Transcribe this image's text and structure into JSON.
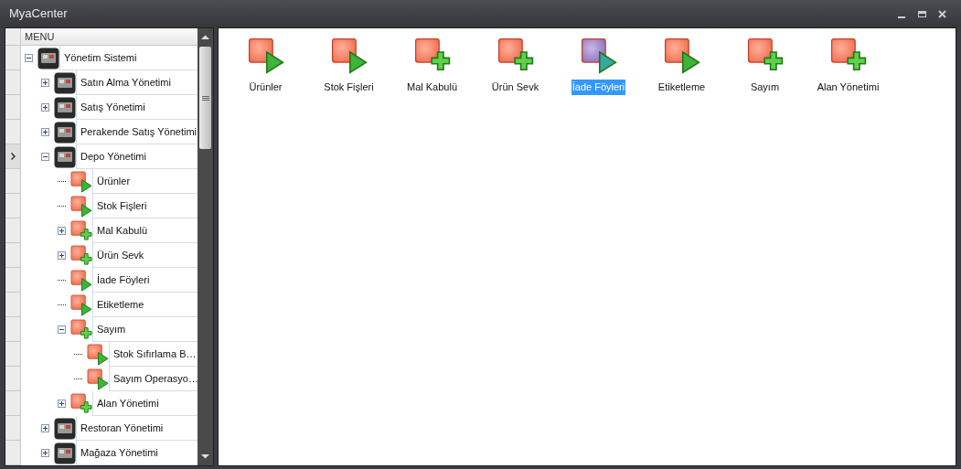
{
  "window": {
    "title": "MyaCenter"
  },
  "tree": {
    "header": "MENU",
    "items": [
      {
        "label": "Yönetim Sistemi",
        "kind": "category",
        "expanded": true,
        "current": false,
        "children": [
          {
            "label": "Satın Alma Yönetimi",
            "kind": "category",
            "expanded": false,
            "current": false
          },
          {
            "label": "Satış Yönetimi",
            "kind": "category",
            "expanded": false,
            "current": false
          },
          {
            "label": "Perakende Satış Yönetimi",
            "kind": "category",
            "expanded": false,
            "current": false
          },
          {
            "label": "Depo Yönetimi",
            "kind": "category",
            "expanded": true,
            "current": true,
            "children": [
              {
                "label": "Ürünler",
                "kind": "run",
                "current": false
              },
              {
                "label": "Stok Fişleri",
                "kind": "run",
                "current": false
              },
              {
                "label": "Mal Kabulü",
                "kind": "add",
                "expanded": false,
                "current": false
              },
              {
                "label": "Ürün Sevk",
                "kind": "add",
                "expanded": false,
                "current": false
              },
              {
                "label": "İade Föyleri",
                "kind": "run",
                "current": false
              },
              {
                "label": "Etiketleme",
                "kind": "run",
                "current": false
              },
              {
                "label": "Sayım",
                "kind": "add",
                "expanded": true,
                "current": false,
                "children": [
                  {
                    "label": "Stok Sıfırlama B…",
                    "kind": "run",
                    "current": false
                  },
                  {
                    "label": "Sayım Operasyo…",
                    "kind": "run",
                    "current": false
                  }
                ]
              },
              {
                "label": "Alan Yönetimi",
                "kind": "add",
                "expanded": false,
                "current": false
              }
            ]
          },
          {
            "label": "Restoran Yönetimi",
            "kind": "category",
            "expanded": false,
            "current": false
          },
          {
            "label": "Mağaza Yönetimi",
            "kind": "category",
            "expanded": false,
            "current": false
          }
        ]
      }
    ]
  },
  "tiles": [
    {
      "label": "Ürünler",
      "kind": "run",
      "selected": false
    },
    {
      "label": "Stok Fişleri",
      "kind": "run",
      "selected": false
    },
    {
      "label": "Mal Kabulü",
      "kind": "add",
      "selected": false
    },
    {
      "label": "Ürün Sevk",
      "kind": "add",
      "selected": false
    },
    {
      "label": "İade Föyleri",
      "kind": "run",
      "selected": true
    },
    {
      "label": "Etiketleme",
      "kind": "run",
      "selected": false
    },
    {
      "label": "Sayım",
      "kind": "add",
      "selected": false
    },
    {
      "label": "Alan Yönetimi",
      "kind": "add",
      "selected": false
    }
  ]
}
